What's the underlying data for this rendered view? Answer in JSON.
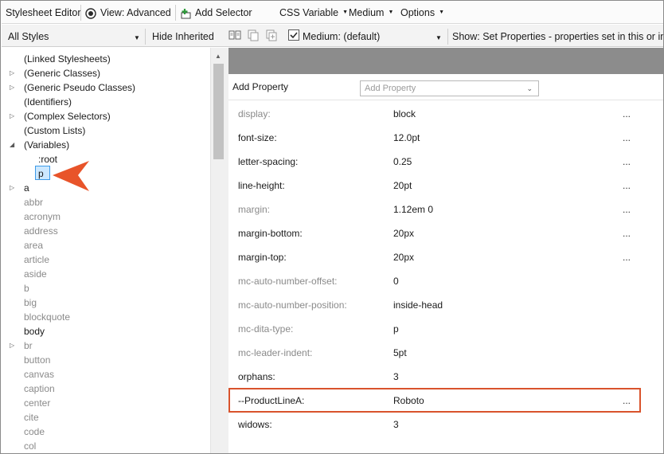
{
  "toolbar": {
    "title": "Stylesheet Editor",
    "view": "View: Advanced",
    "add_selector": "Add Selector",
    "css_variable": "CSS Variable",
    "medium": "Medium",
    "options": "Options"
  },
  "filterbar": {
    "styles_select": "All Styles",
    "hide_inherited": "Hide Inherited",
    "medium_checked": true,
    "medium_select": "Medium: (default)",
    "show_select": "Show: Set Properties - properties set in this or imp"
  },
  "tree": {
    "items": [
      {
        "label": "(Linked Stylesheets)",
        "expander": "",
        "muted": false
      },
      {
        "label": "(Generic Classes)",
        "expander": "collapsed",
        "muted": false
      },
      {
        "label": "(Generic Pseudo Classes)",
        "expander": "collapsed",
        "muted": false
      },
      {
        "label": "(Identifiers)",
        "expander": "",
        "muted": false
      },
      {
        "label": "(Complex Selectors)",
        "expander": "collapsed",
        "muted": false
      },
      {
        "label": "(Custom Lists)",
        "expander": "",
        "muted": false
      },
      {
        "label": "(Variables)",
        "expander": "expanded",
        "muted": false
      },
      {
        "label": ":root",
        "expander": "",
        "muted": false,
        "indent": true
      },
      {
        "label": "p",
        "expander": "",
        "muted": false,
        "indent": true,
        "selected": true
      },
      {
        "label": "a",
        "expander": "collapsed",
        "muted": false
      },
      {
        "label": "abbr",
        "expander": "",
        "muted": true
      },
      {
        "label": "acronym",
        "expander": "",
        "muted": true
      },
      {
        "label": "address",
        "expander": "",
        "muted": true
      },
      {
        "label": "area",
        "expander": "",
        "muted": true
      },
      {
        "label": "article",
        "expander": "",
        "muted": true
      },
      {
        "label": "aside",
        "expander": "",
        "muted": true
      },
      {
        "label": "b",
        "expander": "",
        "muted": true
      },
      {
        "label": "big",
        "expander": "",
        "muted": true
      },
      {
        "label": "blockquote",
        "expander": "",
        "muted": true
      },
      {
        "label": "body",
        "expander": "",
        "muted": false
      },
      {
        "label": "br",
        "expander": "collapsed",
        "muted": true
      },
      {
        "label": "button",
        "expander": "",
        "muted": true
      },
      {
        "label": "canvas",
        "expander": "",
        "muted": true
      },
      {
        "label": "caption",
        "expander": "",
        "muted": true
      },
      {
        "label": "center",
        "expander": "",
        "muted": true
      },
      {
        "label": "cite",
        "expander": "",
        "muted": true
      },
      {
        "label": "code",
        "expander": "",
        "muted": true
      },
      {
        "label": "col",
        "expander": "",
        "muted": true
      }
    ]
  },
  "properties": {
    "add_label": "Add Property",
    "add_placeholder": "Add Property",
    "rows": [
      {
        "name": "display:",
        "value": "block",
        "more": "...",
        "muted": true
      },
      {
        "name": "font-size:",
        "value": "12.0pt",
        "more": "...",
        "muted": false
      },
      {
        "name": "letter-spacing:",
        "value": "0.25",
        "more": "...",
        "muted": false
      },
      {
        "name": "line-height:",
        "value": "20pt",
        "more": "...",
        "muted": false
      },
      {
        "name": "margin:",
        "value": "1.12em 0",
        "more": "...",
        "muted": true
      },
      {
        "name": "margin-bottom:",
        "value": "20px",
        "more": "...",
        "muted": false
      },
      {
        "name": "margin-top:",
        "value": "20px",
        "more": "...",
        "muted": false
      },
      {
        "name": "mc-auto-number-offset:",
        "value": "0",
        "more": "",
        "muted": true
      },
      {
        "name": "mc-auto-number-position:",
        "value": "inside-head",
        "more": "",
        "muted": true
      },
      {
        "name": "mc-dita-type:",
        "value": "p",
        "more": "",
        "muted": true
      },
      {
        "name": "mc-leader-indent:",
        "value": "5pt",
        "more": "",
        "muted": true
      },
      {
        "name": "orphans:",
        "value": "3",
        "more": "",
        "muted": false
      },
      {
        "name": "--ProductLineA:",
        "value": "Roboto",
        "more": "...",
        "muted": false,
        "highlighted": true
      },
      {
        "name": "widows:",
        "value": "3",
        "more": "",
        "muted": false
      }
    ]
  },
  "colors": {
    "highlight_border": "#d9532c",
    "arrow": "#e8542a",
    "selection": "#cce8ff",
    "header_bar": "#8c8c8c"
  }
}
